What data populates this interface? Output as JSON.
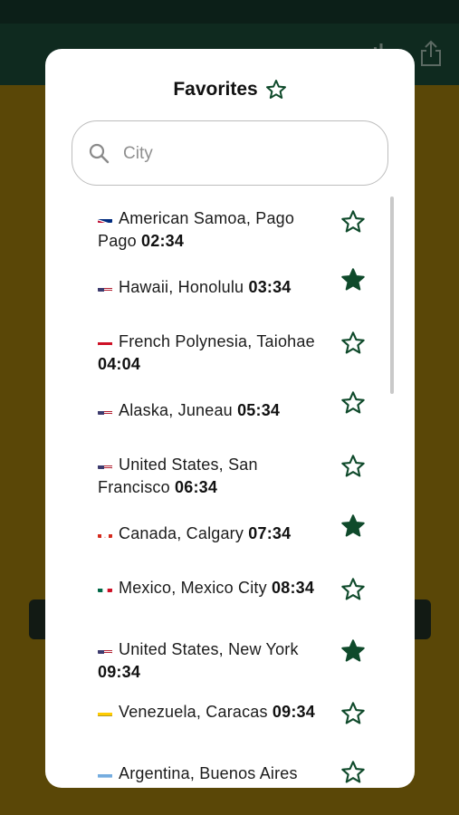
{
  "modal": {
    "title": "Favorites",
    "search": {
      "placeholder": "City",
      "value": ""
    }
  },
  "colors": {
    "star": "#0f4a2b",
    "accent_bg": "#5a4707",
    "nav_bg": "#0f2a1f"
  },
  "favorites": [
    {
      "place": "American Samoa, Pago Pago",
      "time": "02:34",
      "flag": "AS",
      "favorite": false
    },
    {
      "place": "Hawaii, Honolulu",
      "time": "03:34",
      "flag": "US-HI",
      "favorite": true
    },
    {
      "place": "French Polynesia, Taiohae",
      "time": "04:04",
      "flag": "PF",
      "favorite": false
    },
    {
      "place": "Alaska, Juneau",
      "time": "05:34",
      "flag": "US",
      "favorite": false
    },
    {
      "place": "United States, San Francisco",
      "time": "06:34",
      "flag": "US",
      "favorite": false
    },
    {
      "place": "Canada, Calgary",
      "time": "07:34",
      "flag": "CA",
      "favorite": true
    },
    {
      "place": "Mexico, Mexico City",
      "time": "08:34",
      "flag": "MX",
      "favorite": false
    },
    {
      "place": "United States, New York",
      "time": "09:34",
      "flag": "US",
      "favorite": true
    },
    {
      "place": "Venezuela, Caracas",
      "time": "09:34",
      "flag": "VE",
      "favorite": false
    },
    {
      "place": "Argentina, Buenos Aires",
      "time": "",
      "flag": "AR",
      "favorite": false
    }
  ]
}
